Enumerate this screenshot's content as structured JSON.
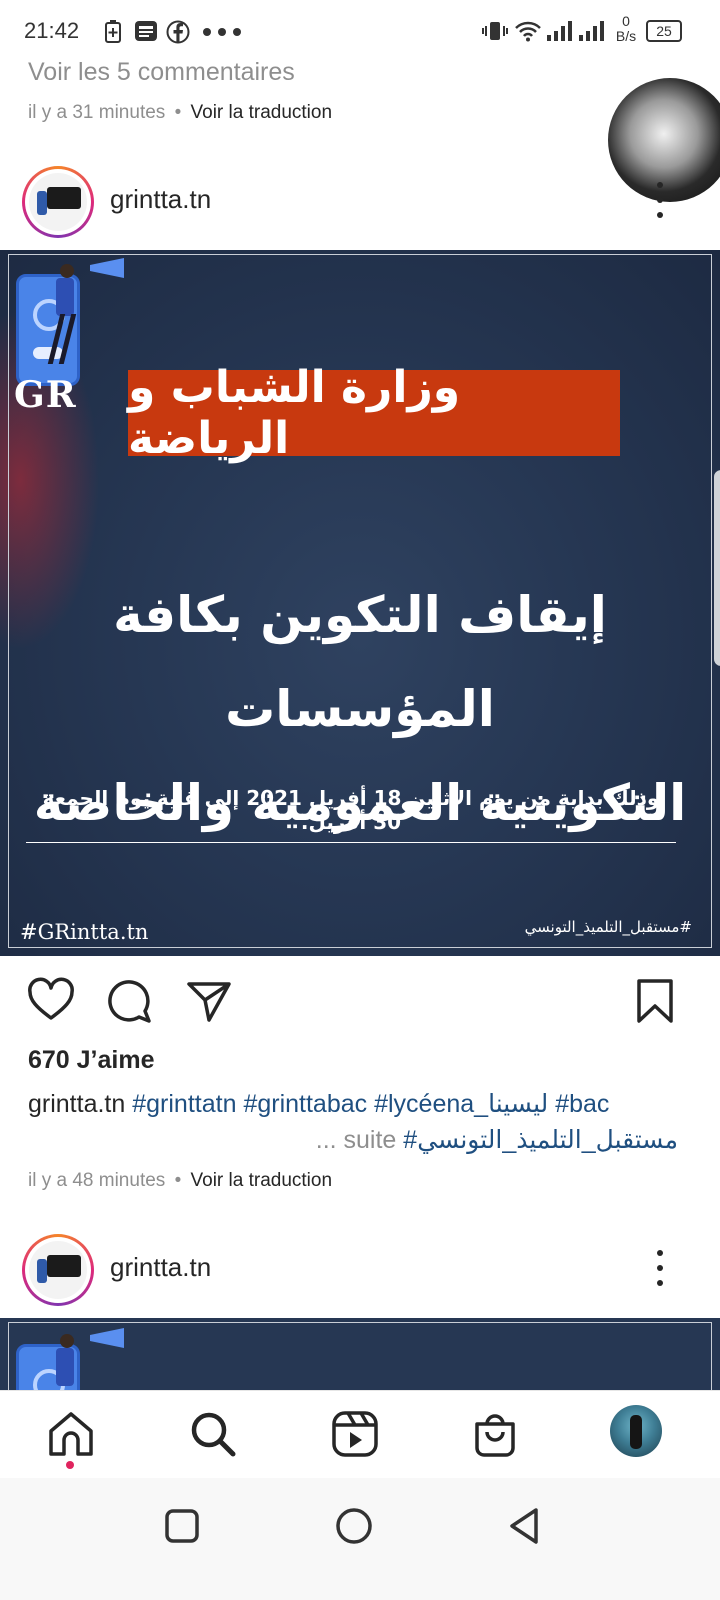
{
  "status_bar": {
    "time": "21:42",
    "net_speed_value": "0",
    "net_speed_unit": "B/s",
    "battery": "25",
    "icons": [
      "battery-saver-icon",
      "news-icon",
      "facebook-icon",
      "more-dots-icon",
      "vibrate-icon",
      "wifi-icon",
      "signal-icon",
      "signal-icon"
    ]
  },
  "previous_post": {
    "view_comments": "Voir les 5 commentaires",
    "time_ago": "il y a 31 minutes",
    "separator": "•",
    "translate": "Voir la traduction"
  },
  "post": {
    "username": "grintta.tn",
    "image": {
      "logo_text": "GR",
      "title": "وزارة الشباب و الرياضة",
      "headline_line1": "إيقاف التكوين بكافة المؤسسات",
      "headline_line2": "التكوينية العمومية والخاصة",
      "subline": "وذلك بداية من يوم الاثنين 18 أفريل 2021 إلى غاية يوم الجمعة 30 أفريل.",
      "hashtag_left": "#GRintta.tn",
      "hashtag_right": "#مستقبل_التلميذ_التونسي",
      "title_bg_color": "#c8390f",
      "bg_color": "#263753"
    },
    "likes": "670 J’aime",
    "caption": {
      "username": "grintta.tn",
      "tag1": "#grinttatn",
      "tag2": "#grinttabac",
      "tag3": "#lycéena_ليسينا",
      "tag4": "#bac",
      "line2_tag": "#مستقبل_التلميذ_التونسي",
      "more": "... suite"
    },
    "time_ago": "il y a 48 minutes",
    "separator": "•",
    "translate": "Voir la traduction"
  },
  "next_post": {
    "username": "grintta.tn"
  },
  "bottom_nav": {
    "items": [
      "home-icon",
      "search-icon",
      "reels-icon",
      "shop-icon",
      "profile-avatar"
    ],
    "notification_dot_color": "#e0245e"
  },
  "system_nav": {
    "items": [
      "recents-button",
      "home-button",
      "back-button"
    ]
  }
}
